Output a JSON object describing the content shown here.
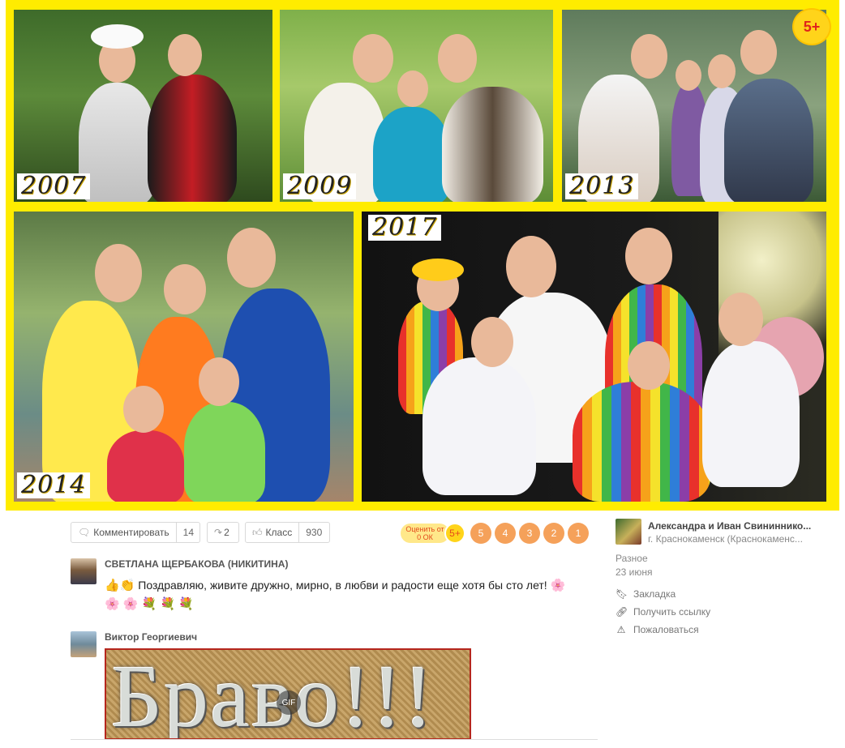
{
  "collage": {
    "years": [
      "2007",
      "2009",
      "2013",
      "2014",
      "2017"
    ],
    "badge": "5+"
  },
  "actions": {
    "comment_label": "Комментировать",
    "comment_count": "14",
    "share_count": "2",
    "like_label": "Класс",
    "like_count": "930"
  },
  "rating": {
    "label": "Оценить от 0 ОК",
    "plus": "5+",
    "values": [
      "5",
      "4",
      "3",
      "2",
      "1"
    ]
  },
  "comments": [
    {
      "author": "СВЕТЛАНА ЩЕРБАКОВА (НИКИТИНА)",
      "text": "Поздравляю, живите дружно, мирно, в любви и радости еще хотя бы сто лет!",
      "emoji_before": "👍👏",
      "emoji_after": "🌸",
      "emoji_line": "🌸 🌸 💐 💐 💐"
    },
    {
      "author": "Виктор Георгиевич",
      "image_text": "Браво!!!",
      "gif_tag": "GIF"
    }
  ],
  "sidebar": {
    "group_name": "Александра и Иван Свининнико...",
    "group_city": "г. Краснокаменск (Краснокаменс...",
    "category": "Разное",
    "date": "23 июня",
    "links": [
      {
        "label": "Закладка",
        "icon": "bookmark-icon"
      },
      {
        "label": "Получить ссылку",
        "icon": "link-icon"
      },
      {
        "label": "Пожаловаться",
        "icon": "warning-icon"
      }
    ]
  },
  "colors": {
    "frame": "#ffec00",
    "rate_circle": "#f5a15a",
    "badge": "#ffd41a"
  }
}
